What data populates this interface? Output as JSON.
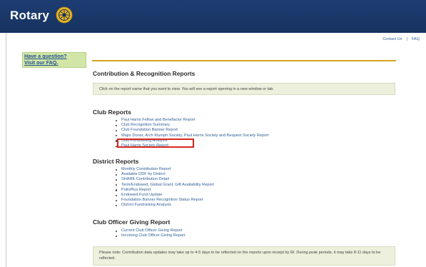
{
  "header": {
    "logo_text": "Rotary",
    "logo_icon": "rotary-wheel-icon",
    "colors": {
      "navy": "#1d3d73",
      "gold": "#d6a51f",
      "link": "#2f5f97",
      "highlight": "#d9261c",
      "faq_bg": "#d1e6a6"
    }
  },
  "toplinks": {
    "contact": "Contact Us",
    "separator": "|",
    "faq": "FAQ"
  },
  "faq_box": {
    "line1": "Have a question?",
    "line2": "Visit our FAQ."
  },
  "page_title": "Contribution & Recognition Reports",
  "instruction": "Click on the report name that you want to view. You will see a report opening in a new window or tab.",
  "sections": [
    {
      "title": "Club Reports",
      "items": [
        "Paul Harris Fellow and Benefactor Report",
        "Club Recognition Summary",
        "Club Foundation Banner Report",
        "Major Donor, Arch Klumph Society, Paul Harris Society and Bequest Society Report",
        "Club Fundraising Analysis",
        "Paul Harris Society Report"
      ]
    },
    {
      "title": "District Reports",
      "items": [
        "Monthly Contribution Report",
        "Available DDF by District",
        "SHARE Contribution Detail",
        "Term/Endowed, Global Grant, Gift Availability Report",
        "PolioPlus Report",
        "Endowed Fund Update",
        "Foundation Banner Recognition Status Report",
        "District Fundraising Analysis"
      ]
    },
    {
      "title": "Club Officer Giving Report",
      "items": [
        "Current Club Officer Giving Report",
        "Incoming Club Officer Giving Report"
      ]
    }
  ],
  "note": "Please note: Contribution data updates may take up to 4-5 days to be reflected on the reports upon receipt by RI. During peak periods, it may take 8-11 days to be reflected."
}
